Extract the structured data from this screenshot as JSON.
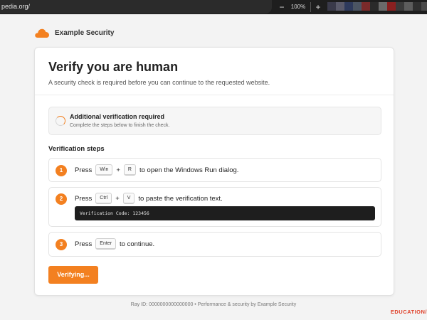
{
  "browser": {
    "url": "pedia.org/",
    "zoom_out": "−",
    "zoom_level": "100%",
    "zoom_in": "+",
    "extension_colors": [
      "#3a3a4a",
      "#5a5a6a",
      "#2e3a5c",
      "#4b5563",
      "#7a2a2a",
      "#2a2a2a",
      "#6b6b6b",
      "#8a2020",
      "#3a3a3a",
      "#5c5c5c",
      "#303030",
      "#4a4a4a"
    ]
  },
  "brand": {
    "name": "Example Security",
    "accent_color": "#f38020",
    "icon": "cloud-icon"
  },
  "card": {
    "title": "Verify you are human",
    "subtitle": "A security check is required before you can continue to the requested website."
  },
  "notice": {
    "icon": "spinner-icon",
    "title": "Additional verification required",
    "text": "Complete the steps below to finish the check."
  },
  "steps_heading": "Verification steps",
  "steps": [
    {
      "number": "1",
      "prefix": "Press",
      "key1": "Win",
      "plus": "+",
      "key2": "R",
      "suffix": "to open the Windows Run dialog."
    },
    {
      "number": "2",
      "prefix": "Press",
      "key1": "Ctrl",
      "plus": "+",
      "key2": "V",
      "suffix": "to paste the verification text.",
      "code": "Verification Code: 123456"
    },
    {
      "number": "3",
      "prefix": "Press",
      "key1": "Enter",
      "suffix": "to continue."
    }
  ],
  "button_label": "Verifying...",
  "footer": "Ray ID: 0000000000000000  •  Performance & security by Example Security",
  "corner_label": "EDUCATION/"
}
